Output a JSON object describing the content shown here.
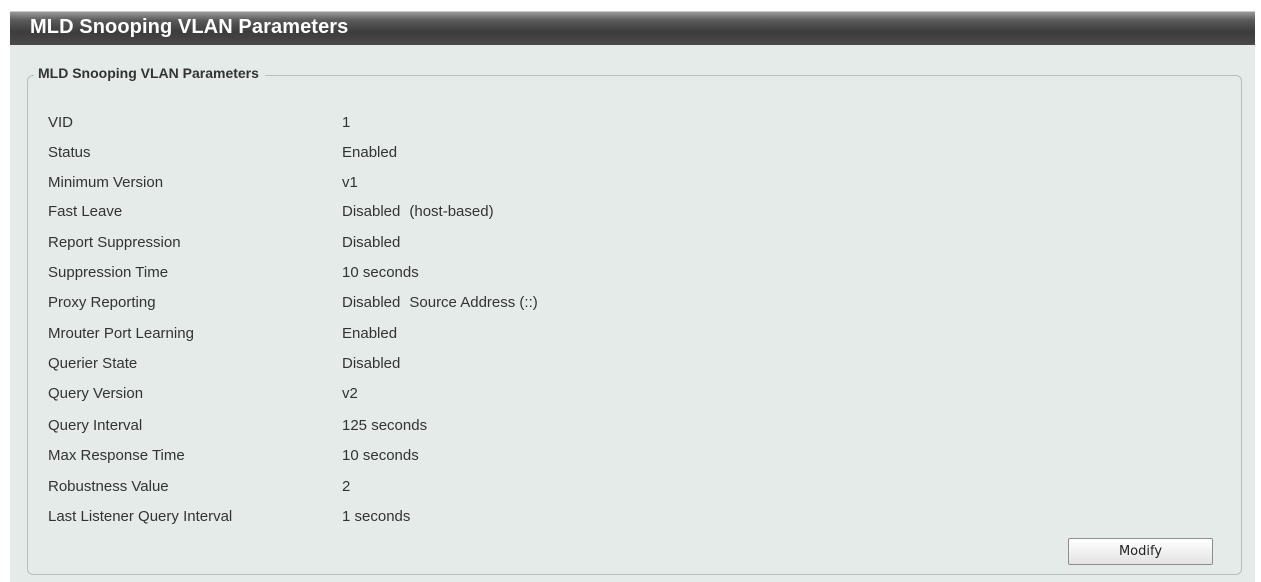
{
  "header": {
    "title": "MLD Snooping VLAN Parameters"
  },
  "panel": {
    "legend": "MLD Snooping VLAN Parameters",
    "rows": [
      {
        "label": "VID",
        "value": "1",
        "extra": ""
      },
      {
        "label": "Status",
        "value": "Enabled",
        "extra": ""
      },
      {
        "label": "Minimum Version",
        "value": "v1",
        "extra": ""
      },
      {
        "label": "Fast Leave",
        "value": "Disabled",
        "extra": "(host-based)"
      },
      {
        "label": "Report Suppression",
        "value": "Disabled",
        "extra": ""
      },
      {
        "label": "Suppression Time",
        "value": "10 seconds",
        "extra": ""
      },
      {
        "label": "Proxy Reporting",
        "value": "Disabled",
        "extra": "Source Address (::)"
      },
      {
        "label": "Mrouter Port Learning",
        "value": "Enabled",
        "extra": ""
      },
      {
        "label": "Querier State",
        "value": "Disabled",
        "extra": ""
      },
      {
        "label": "Query Version",
        "value": "v2",
        "extra": ""
      },
      {
        "label": "Query Interval",
        "value": "125 seconds",
        "extra": ""
      },
      {
        "label": "Max Response Time",
        "value": "10 seconds",
        "extra": ""
      },
      {
        "label": "Robustness Value",
        "value": "2",
        "extra": ""
      },
      {
        "label": "Last Listener Query Interval",
        "value": "1 seconds",
        "extra": ""
      }
    ],
    "modify_label": "Modify"
  }
}
